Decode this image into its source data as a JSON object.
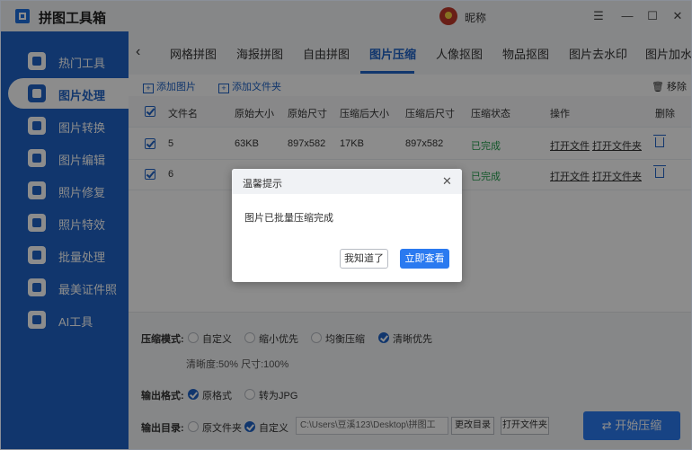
{
  "app": {
    "title": "拼图工具箱",
    "nickname": "昵称",
    "accent": "#1f63c6"
  },
  "window_controls": {
    "menu": "☰",
    "minimize": "—",
    "maximize": "☐",
    "close": "✕"
  },
  "sidebar": {
    "items": [
      {
        "label": "热门工具"
      },
      {
        "label": "图片处理",
        "active": true
      },
      {
        "label": "图片转换"
      },
      {
        "label": "图片编辑"
      },
      {
        "label": "照片修复"
      },
      {
        "label": "照片特效"
      },
      {
        "label": "批量处理"
      },
      {
        "label": "最美证件照"
      },
      {
        "label": "AI工具"
      }
    ]
  },
  "tabs": {
    "back": "‹",
    "items": [
      {
        "label": "网格拼图"
      },
      {
        "label": "海报拼图"
      },
      {
        "label": "自由拼图"
      },
      {
        "label": "图片压缩",
        "active": true
      },
      {
        "label": "人像抠图"
      },
      {
        "label": "物品抠图"
      },
      {
        "label": "图片去水印"
      },
      {
        "label": "图片加水"
      }
    ]
  },
  "toolbar": {
    "add_image": "添加图片",
    "add_folder": "添加文件夹",
    "remove": "移除"
  },
  "table": {
    "headers": [
      "文件名",
      "原始大小",
      "原始尺寸",
      "压缩后大小",
      "压缩后尺寸",
      "压缩状态",
      "操作",
      "删除"
    ],
    "rows": [
      {
        "name": "5",
        "orig_size": "63KB",
        "orig_dim": "897x582",
        "new_size": "17KB",
        "new_dim": "897x582",
        "status": "已完成",
        "open_file": "打开文件",
        "open_folder": "打开文件夹"
      },
      {
        "name": "6",
        "orig_size": "",
        "orig_dim": "",
        "new_size": "",
        "new_dim": "",
        "status": "已完成",
        "open_file": "打开文件",
        "open_folder": "打开文件夹"
      }
    ]
  },
  "settings": {
    "mode_label": "压缩模式:",
    "modes": [
      "自定义",
      "缩小优先",
      "均衡压缩",
      "清晰优先"
    ],
    "mode_selected": "清晰优先",
    "info": "清晰度:50%   尺寸:100%",
    "format_label": "输出格式:",
    "formats": [
      "原格式",
      "转为JPG"
    ],
    "format_selected": "原格式",
    "dir_label": "输出目录:",
    "dirs": [
      "原文件夹",
      "自定义"
    ],
    "dir_selected": "自定义",
    "path": "C:\\Users\\豆溪123\\Desktop\\拼图工",
    "change_dir": "更改目录",
    "open_folder": "打开文件夹",
    "start": "开始压缩"
  },
  "dialog": {
    "title": "温馨提示",
    "message": "图片已批量压缩完成",
    "ok": "我知道了",
    "view": "立即查看"
  }
}
